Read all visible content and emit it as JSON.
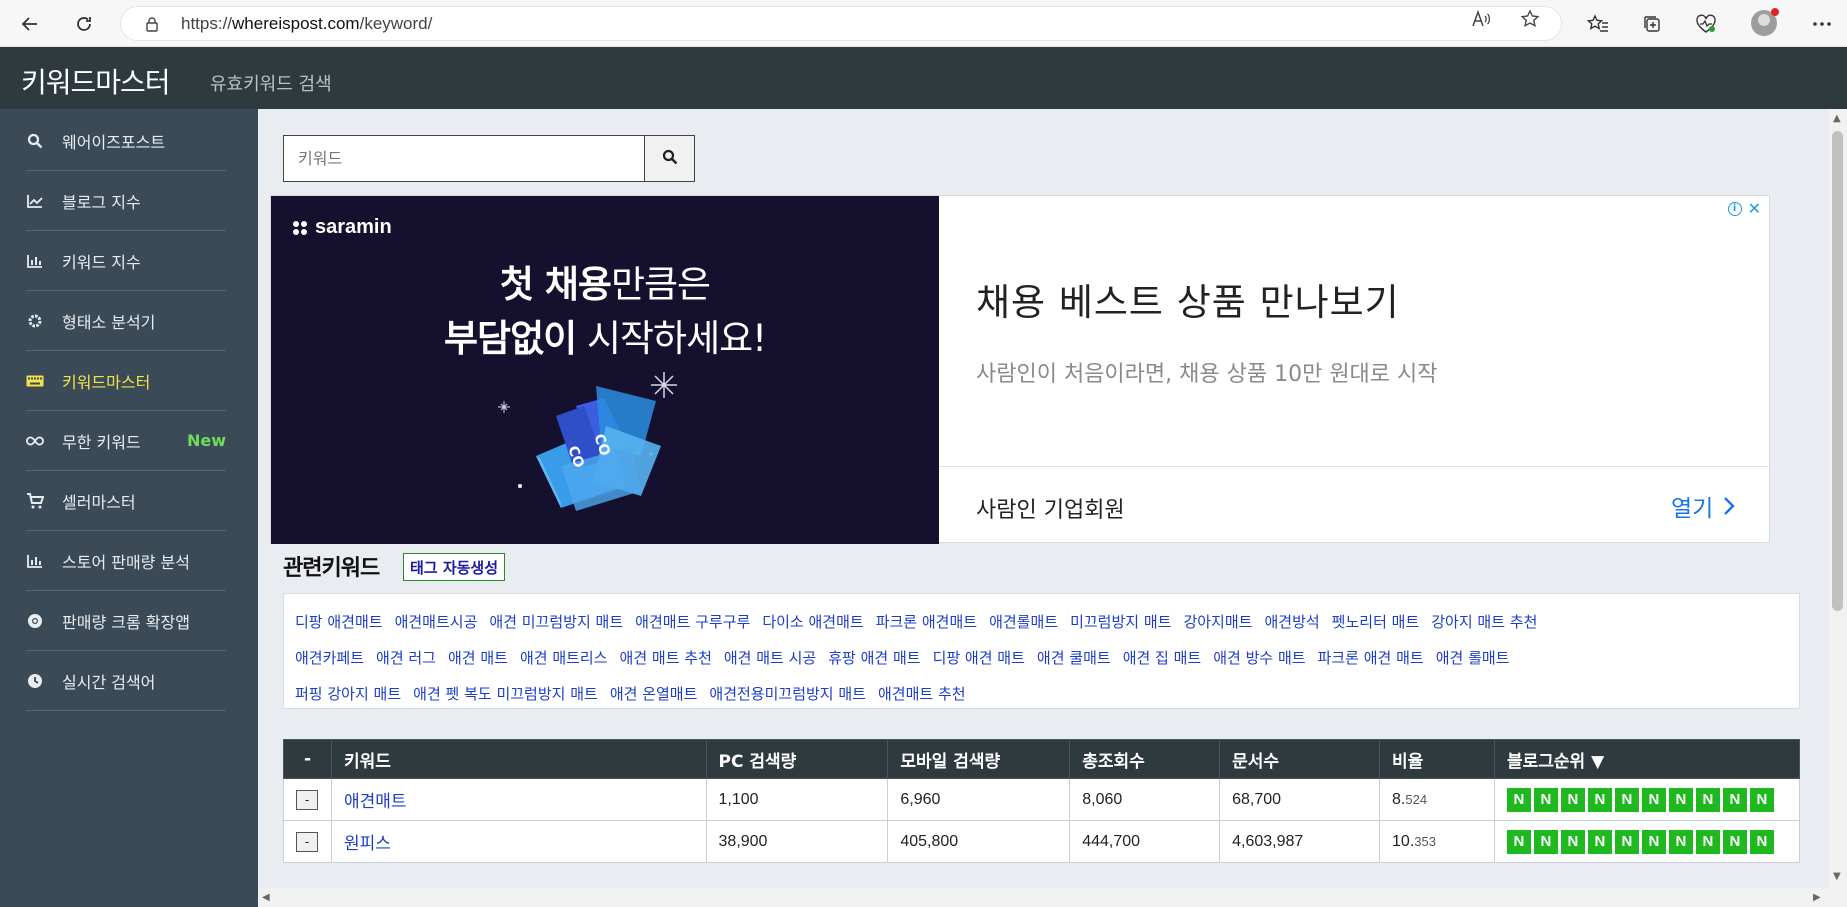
{
  "browser": {
    "url_prefix": "https://",
    "url_host": "whereispost.com",
    "url_path": "/keyword/"
  },
  "header": {
    "brand": "키워드마스터",
    "subtitle": "유효키워드 검색"
  },
  "sidebar": {
    "items": [
      {
        "label": "웨어이즈포스트",
        "icon": "search-icon"
      },
      {
        "label": "블로그 지수",
        "icon": "line-chart-icon"
      },
      {
        "label": "키워드 지수",
        "icon": "bar-chart-icon"
      },
      {
        "label": "형태소 분석기",
        "icon": "gear-icon"
      },
      {
        "label": "키워드마스터",
        "icon": "keyboard-icon",
        "active": true
      },
      {
        "label": "무한 키워드",
        "icon": "infinity-icon",
        "badge": "New"
      },
      {
        "label": "셀러마스터",
        "icon": "cart-icon"
      },
      {
        "label": "스토어 판매량 분석",
        "icon": "bar-chart-icon"
      },
      {
        "label": "판매량 크롬 확장앱",
        "icon": "chrome-icon"
      },
      {
        "label": "실시간 검색어",
        "icon": "clock-icon"
      }
    ],
    "active_color": "#f3e34a",
    "badge_color": "#6fdc5a"
  },
  "search": {
    "placeholder": "키워드"
  },
  "ad": {
    "logo": "saramin",
    "headline_1_bold": "첫 채용",
    "headline_1_rest": "만큼은",
    "headline_2_bold": "부담없이",
    "headline_2_rest": " 시작하세요!",
    "title": "채용 베스트 상품 만나보기",
    "description": "사람인이 처음이라면, 채용 상품 10만 원대로 시작",
    "company": "사람인 기업회원",
    "open_label": "열기"
  },
  "related": {
    "title": "관련키워드",
    "tag_button": "태그 자동생성",
    "rows": [
      [
        "디팡 애견매트",
        "애견매트시공",
        "애견 미끄럼방지 매트",
        "애견매트 구루구루",
        "다이소 애견매트",
        "파크론 애견매트",
        "애견롤매트",
        "미끄럼방지 매트",
        "강아지매트",
        "애견방석",
        "펫노리터 매트",
        "강아지 매트 추천"
      ],
      [
        "애견카페트",
        "애견 러그",
        "애견 매트",
        "애견 매트리스",
        "애견 매트 추천",
        "애견 매트 시공",
        "휴팡 애견 매트",
        "디팡 애견 매트",
        "애견 쿨매트",
        "애견 집 매트",
        "애견 방수 매트",
        "파크론 애견 매트",
        "애견 롤매트"
      ],
      [
        "퍼핑 강아지 매트",
        "애견 펫 복도 미끄럼방지 매트",
        "애견 온열매트",
        "애견전용미끄럼방지 매트",
        "애견매트 추천"
      ]
    ]
  },
  "table": {
    "headers": [
      "-",
      "키워드",
      "PC 검색량",
      "모바일 검색량",
      "총조회수",
      "문서수",
      "비율",
      "블로그순위 ▼"
    ],
    "rows": [
      {
        "btn": "-",
        "keyword": "애견매트",
        "pc": "1,100",
        "mobile": "6,960",
        "total": "8,060",
        "docs": "68,700",
        "ratio_int": "8.",
        "ratio_dec": "524",
        "rank": [
          "N",
          "N",
          "N",
          "N",
          "N",
          "N",
          "N",
          "N",
          "N",
          "N"
        ]
      },
      {
        "btn": "-",
        "keyword": "원피스",
        "pc": "38,900",
        "mobile": "405,800",
        "total": "444,700",
        "docs": "4,603,987",
        "ratio_int": "10.",
        "ratio_dec": "353",
        "rank": [
          "N",
          "N",
          "N",
          "N",
          "N",
          "N",
          "N",
          "N",
          "N",
          "N"
        ]
      }
    ]
  }
}
